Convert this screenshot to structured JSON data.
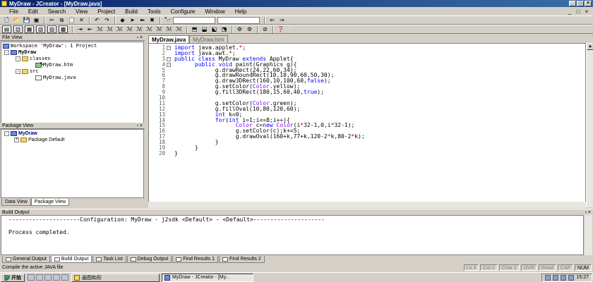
{
  "window": {
    "title": "MyDraw - JCreator - [MyDraw.java]"
  },
  "menu": [
    "File",
    "Edit",
    "Search",
    "View",
    "Project",
    "Build",
    "Tools",
    "Configure",
    "Window",
    "Help"
  ],
  "mdi_controls": [
    "_",
    "□",
    "×"
  ],
  "file_view": {
    "header": "File View",
    "pin": "▫ ×",
    "workspace": "Workspace 'MyDraw': 1 Project",
    "project": "MyDraw",
    "classes": "classes",
    "html_file": "MyDraw.htm",
    "src": "src",
    "java_file": "MyDraw.java",
    "tabs": [
      "Data View",
      "Package View"
    ]
  },
  "package_view": {
    "header": "Package View",
    "pin": "▫ ×",
    "project": "MyDraw",
    "package": "Package Default"
  },
  "editor": {
    "tabs": [
      "MyDraw.java",
      "MyDraw.htm"
    ],
    "line_numbers": [
      "1",
      "2",
      "3",
      "4",
      "5",
      "6",
      "7",
      "8",
      "9",
      "10",
      "11",
      "12",
      "13",
      "14",
      "15",
      "16",
      "17",
      "18",
      "19",
      "20"
    ]
  },
  "build_output": {
    "header": "Build Output",
    "pin": "▫ ×",
    "lines": [
      "---------------------Configuration: MyDraw - j2sdk <Default> - <Default>---------------------",
      "",
      "Process completed."
    ],
    "tabs": [
      "General Output",
      "Build Output",
      "Task List",
      "Debug Output",
      "Find Results 1",
      "Find Results 2"
    ]
  },
  "status": {
    "message": "Compile the active JAVA file",
    "ln": "Ln 4",
    "col": "Col 1",
    "char": "Char 1",
    "ovr": "OVR",
    "read": "Read",
    "cap": "CAP",
    "num": "NUM"
  },
  "taskbar": {
    "start": "开始",
    "tasks": [
      "画图和形",
      "MyDraw - JCreator - [My..."
    ],
    "clock": "15:27"
  }
}
